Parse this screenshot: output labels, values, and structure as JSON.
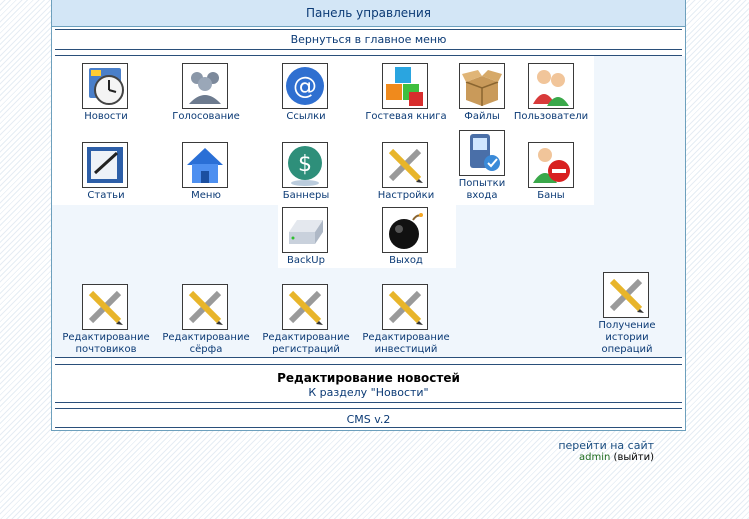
{
  "header": {
    "title": "Панель управления"
  },
  "nav": {
    "back_label": "Вернуться в главное меню"
  },
  "modules": [
    {
      "label": "Новости",
      "icon": "clock-calendar-icon"
    },
    {
      "label": "Голосование",
      "icon": "users-group-icon"
    },
    {
      "label": "Ссылки",
      "icon": "at-sign-icon"
    },
    {
      "label": "Гостевая книга",
      "icon": "colored-cubes-icon"
    },
    {
      "label": "Файлы",
      "icon": "open-box-icon"
    },
    {
      "label": "Пользователи",
      "icon": "two-users-icon"
    },
    {
      "label": "Статьи",
      "icon": "document-pen-icon"
    },
    {
      "label": "Меню",
      "icon": "house-icon"
    },
    {
      "label": "Баннеры",
      "icon": "dollar-icon"
    },
    {
      "label": "Настройки",
      "icon": "pencil-tools-icon"
    },
    {
      "label": "Попытки входа",
      "icon": "mobile-phone-icon"
    },
    {
      "label": "Баны",
      "icon": "user-ban-icon"
    },
    {
      "label": "BackUp",
      "icon": "drive-icon"
    },
    {
      "label": "Выход",
      "icon": "bomb-icon"
    }
  ],
  "extras": [
    {
      "label": "Редактирование почтовиков",
      "icon": "pencil-tools-icon"
    },
    {
      "label": "Редактирование сёрфа",
      "icon": "pencil-tools-icon"
    },
    {
      "label": "Редактирование регистраций",
      "icon": "pencil-tools-icon"
    },
    {
      "label": "Редактирование инвестиций",
      "icon": "pencil-tools-icon"
    },
    {
      "label": "Получение истории операций",
      "icon": "pencil-tools-icon"
    }
  ],
  "section": {
    "title": "Редактирование новостей",
    "link": "К разделу \"Новости\""
  },
  "footer": {
    "version": "CMS v.2"
  },
  "site": {
    "goto_label": "перейти на сайт",
    "user": "admin",
    "logout_label": "выйти"
  },
  "colors": {
    "accent": "#0b3a75",
    "header_bg": "#d3e6f6",
    "panel_border": "#6da0bd"
  }
}
